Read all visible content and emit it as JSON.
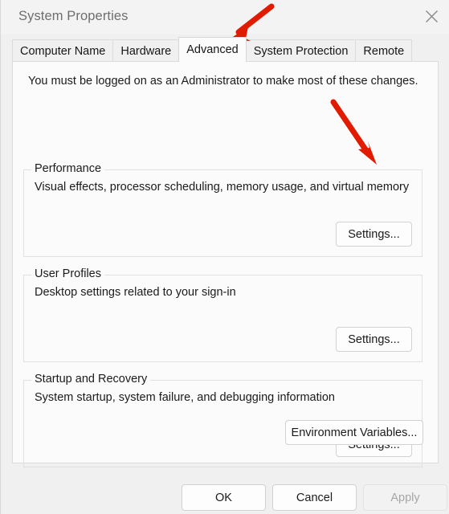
{
  "window": {
    "title": "System Properties",
    "close_icon": "close-icon"
  },
  "tabs": [
    {
      "label": "Computer Name",
      "selected": false
    },
    {
      "label": "Hardware",
      "selected": false
    },
    {
      "label": "Advanced",
      "selected": true
    },
    {
      "label": "System Protection",
      "selected": false
    },
    {
      "label": "Remote",
      "selected": false
    }
  ],
  "panel": {
    "admin_note": "You must be logged on as an Administrator to make most of these changes.",
    "groups": [
      {
        "label": "Performance",
        "description": "Visual effects, processor scheduling, memory usage, and virtual memory",
        "button": "Settings..."
      },
      {
        "label": "User Profiles",
        "description": "Desktop settings related to your sign-in",
        "button": "Settings..."
      },
      {
        "label": "Startup and Recovery",
        "description": "System startup, system failure, and debugging information",
        "button": "Settings..."
      }
    ],
    "environment_variables_button": "Environment Variables..."
  },
  "footer": {
    "ok": "OK",
    "cancel": "Cancel",
    "apply": "Apply"
  },
  "annotations": {
    "arrow_color": "#e01b00",
    "arrow_1_target": "Advanced tab",
    "arrow_2_target": "Performance Settings button"
  }
}
